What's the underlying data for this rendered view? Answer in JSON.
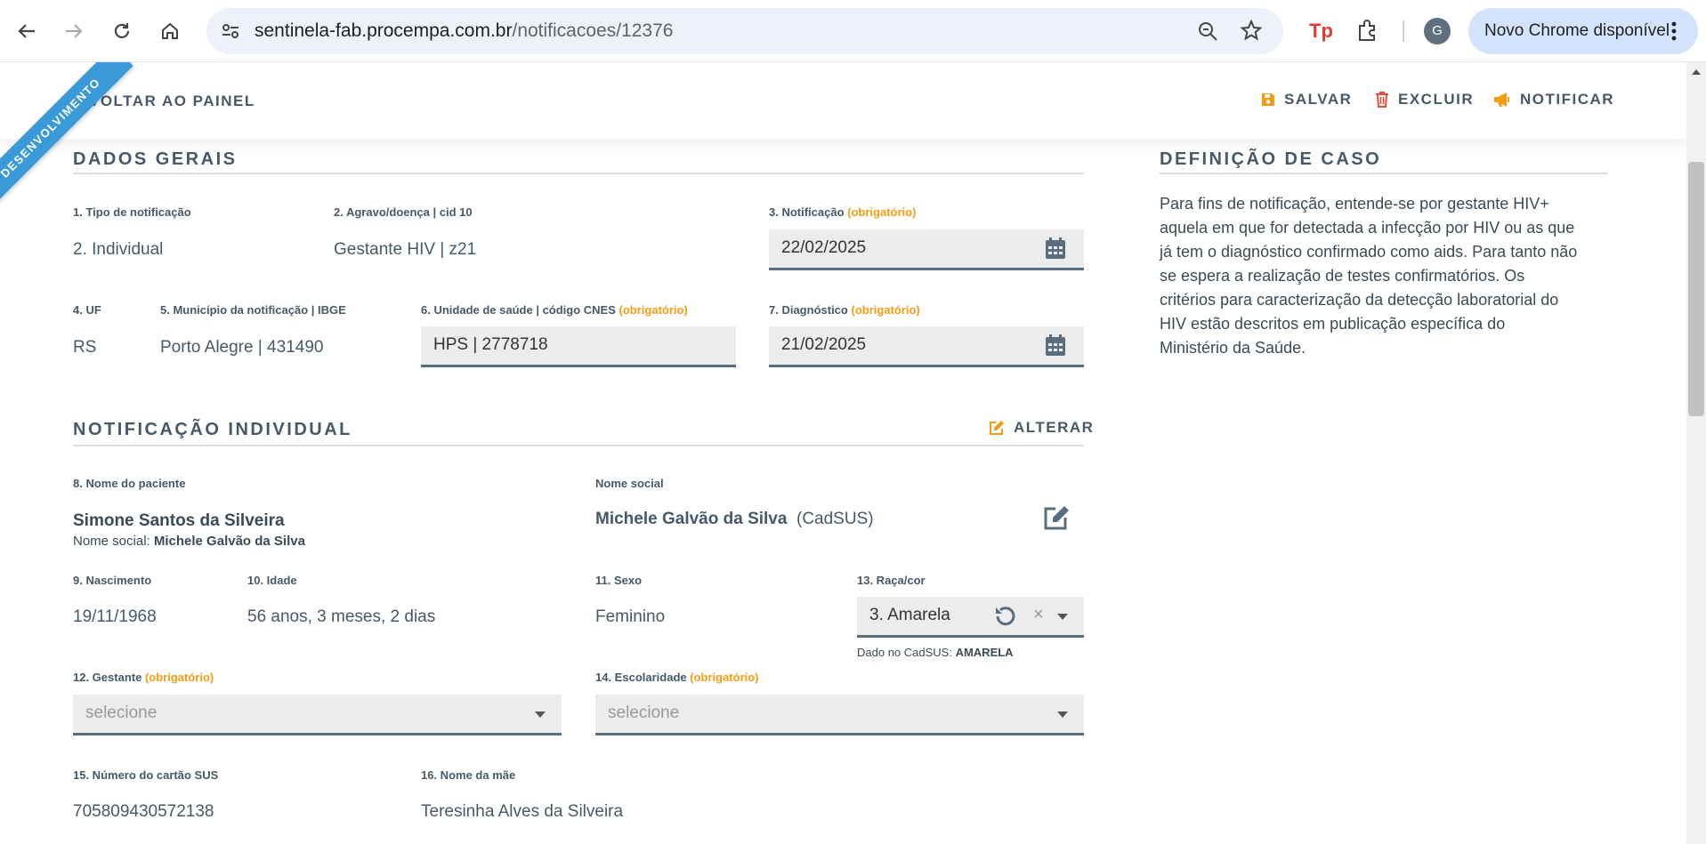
{
  "browser": {
    "url_host": "sentinela-fab.procempa.com.br",
    "url_path": "/notificacoes/12376",
    "profile_initial": "G",
    "update_label": "Novo Chrome disponível"
  },
  "ribbon": "DESENVOLVIMENTO",
  "topbar": {
    "back": "VOLTAR AO PAINEL",
    "save": "SALVAR",
    "delete": "EXCLUIR",
    "notify": "NOTIFICAR"
  },
  "colors": {
    "accent": "#f39c12",
    "danger": "#e74c3c",
    "ribbon": "#3a9ad9",
    "text": "#46596a"
  },
  "dados_gerais": {
    "title": "DADOS GERAIS",
    "tipo_label": "1. Tipo de notificação",
    "tipo_value": "2. Individual",
    "agravo_label": "2. Agravo/doença | cid 10",
    "agravo_value": "Gestante HIV | z21",
    "notificacao_label": "3. Notificação",
    "required": "(obrigatório)",
    "notificacao_value": "22/02/2025",
    "uf_label": "4. UF",
    "uf_value": "RS",
    "municipio_label": "5. Município da notificação | IBGE",
    "municipio_value": "Porto Alegre | 431490",
    "unidade_label": "6. Unidade de saúde | código CNES",
    "unidade_value": "HPS | 2778718",
    "diagnostico_label": "7. Diagnóstico",
    "diagnostico_value": "21/02/2025"
  },
  "definicao": {
    "title": "DEFINIÇÃO DE CASO",
    "text": "Para fins de notificação, entende-se por gestante HIV+ aquela em que for detectada a infecção por HIV ou as que já tem o diagnóstico confirmado como aids. Para tanto não se espera a realização de testes confirmatórios. Os critérios para caracterização da detecção laboratorial do HIV estão descritos em publicação específica do Ministério da Saúde."
  },
  "individual": {
    "title": "NOTIFICAÇÃO INDIVIDUAL",
    "alterar": "ALTERAR",
    "nome_label": "8. Nome do paciente",
    "nome_value": "Simone Santos da Silveira",
    "nome_social_prefix": "Nome social:",
    "nome_social_value": "Michele Galvão da Silva",
    "social_label": "Nome social",
    "social_value": "Michele Galvão da Silva",
    "social_source": "(CadSUS)",
    "nascimento_label": "9. Nascimento",
    "nascimento_value": "19/11/1968",
    "idade_label": "10. Idade",
    "idade_value": "56 anos, 3 meses, 2 dias",
    "sexo_label": "11. Sexo",
    "sexo_value": "Feminino",
    "raca_label": "13. Raça/cor",
    "raca_value": "3. Amarela",
    "raca_clear": "×",
    "cadsus_prefix": "Dado no CadSUS:",
    "cadsus_value": "AMARELA",
    "gestante_label": "12. Gestante",
    "gestante_placeholder": "selecione",
    "escolaridade_label": "14. Escolaridade",
    "escolaridade_placeholder": "selecione",
    "sus_label": "15. Número do cartão SUS",
    "sus_value": "705809430572138",
    "mae_label": "16. Nome da mãe",
    "mae_value": "Teresinha Alves da Silveira"
  }
}
